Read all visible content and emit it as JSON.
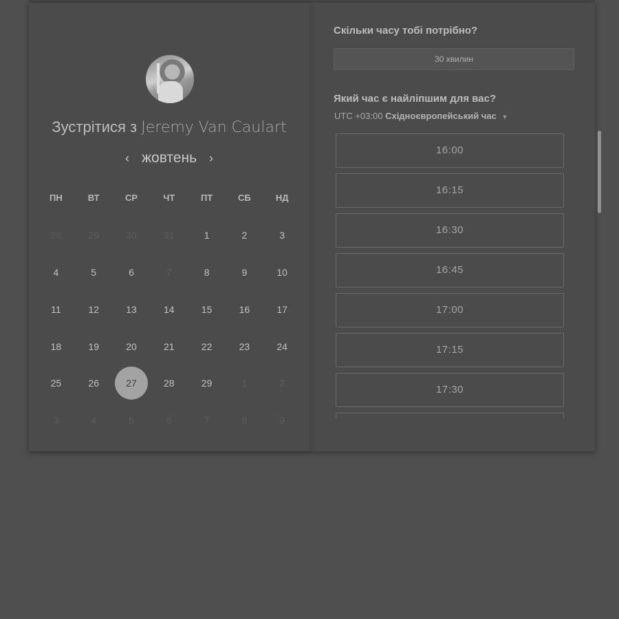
{
  "meeting": {
    "prefix": "Зустрітися з",
    "host_name": "Jeremy Van Caulart"
  },
  "calendar": {
    "month": "жовтень",
    "prev_icon": "chevron-left-icon",
    "next_icon": "chevron-right-icon",
    "weekdays": [
      "ПН",
      "ВТ",
      "СР",
      "ЧТ",
      "ПТ",
      "СБ",
      "НД"
    ],
    "weeks": [
      [
        "28",
        "29",
        "30",
        "31",
        "1",
        "2",
        "3"
      ],
      [
        "4",
        "5",
        "6",
        "7",
        "8",
        "9",
        "10"
      ],
      [
        "11",
        "12",
        "13",
        "14",
        "15",
        "16",
        "17"
      ],
      [
        "18",
        "19",
        "20",
        "21",
        "22",
        "23",
        "24"
      ],
      [
        "25",
        "26",
        "27",
        "28",
        "29",
        "1",
        "2"
      ],
      [
        "3",
        "4",
        "5",
        "6",
        "7",
        "8",
        "9"
      ]
    ],
    "selected_day": "27"
  },
  "duration": {
    "question": "Скільки часу тобі потрібно?",
    "value": "30 хвилин"
  },
  "time": {
    "question": "Який час є найліпшим для вас?",
    "tz_offset": "UTC +03:00",
    "tz_name": "Східноєвропейський час",
    "slots": [
      "16:00",
      "16:15",
      "16:30",
      "16:45",
      "17:00",
      "17:15",
      "17:30",
      ""
    ]
  }
}
